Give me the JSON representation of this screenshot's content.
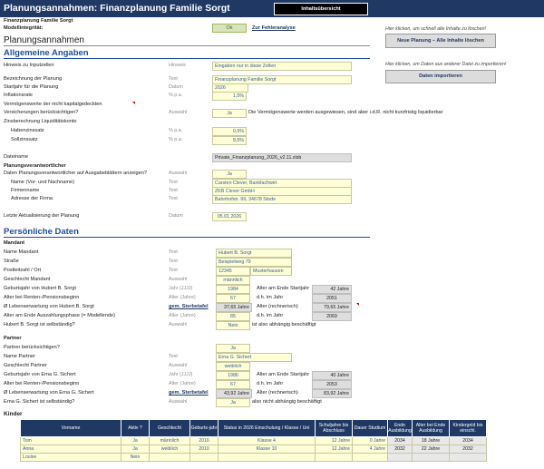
{
  "header": {
    "title": "Planungsannahmen: Finanzplanung Familie Sorgt",
    "overview_button": "Inhaltsübersicht"
  },
  "top": {
    "plan_title": "Finanzplanung Familie Sorgt",
    "integrity_label": "Modellintegrität:",
    "integrity_value": "Ok",
    "error_link": "Zur Fehleranalyse",
    "section_title": "Planungsannahmen",
    "hint_delete": "Hier klicken, um schnell alle Inhalte zu löschen!",
    "new_plan_button": "Neue Planung – Alle Inhalte löschen",
    "hint_import": "Hier klicken, um Daten aus anderer Datei zu importieren!",
    "import_button": "Daten importieren"
  },
  "general": {
    "heading": "Allgemeine Angaben",
    "hint_label": "Hinweis zu Inputzellen",
    "hint_unit": "Hinweis",
    "hint_value": "Eingaben nur in diese Zellen",
    "name_label": "Bezeichnung der Planung",
    "name_unit": "Text",
    "name_value": "Finanzplanung Familie Sorgt",
    "startyear_label": "Startjahr für die Planung",
    "startyear_unit": "Datum",
    "startyear_value": "2026",
    "inflation_label": "Inflationsrate",
    "inflation_unit": "% p.a.",
    "inflation_value": "1,5%",
    "assets_label": "Vermögenswerte der nicht kapitalgedeckten",
    "insurance_label": "Versicherungen berücksichtigen?",
    "insurance_unit": "Auswahl",
    "insurance_value": "Ja",
    "insurance_note": "Die Vermögenswerte werden ausgewiesen, sind aber i.d.R. nicht kurzfristig liquidierbar",
    "interest_label": "Zinsberechnung Liquiditätskonto",
    "credit_label": "Habenzinssatz",
    "credit_unit": "% p.a.",
    "credit_value": "0,5%",
    "debit_label": "Sollzinssatz",
    "debit_unit": "% p.a.",
    "debit_value": "9,5%",
    "filename_label": "Dateiname",
    "filename_value": "Private_Finanzplanung_2026_v2.11.xlsb",
    "resp_heading": "Planungsverantwortlicher",
    "resp_show_label": "Daten Planungsverantwortlicher auf Ausgabeblättern anzeigen?",
    "resp_show_unit": "Auswahl",
    "resp_show_value": "Ja",
    "resp_name_label": "Name (Vor- und Nachname)",
    "resp_name_unit": "Text",
    "resp_name_value": "Carsten Clever, Bankfachwirt",
    "resp_company_label": "Firmenname",
    "resp_company_unit": "Text",
    "resp_company_value": "ZKB Clever GmbH",
    "resp_address_label": "Adresse der Firma",
    "resp_address_unit": "Text",
    "resp_address_value": "Bahnhofstr. 99, 34678 Stode",
    "update_label": "Letzte Aktualisierung der Planung",
    "update_unit": "Datum",
    "update_value": "05.01.2026"
  },
  "personal": {
    "heading": "Persönliche Daten",
    "mandant_heading": "Mandant",
    "name_label": "Name Mandant",
    "name_unit": "Text",
    "name_value": "Hubert B. Sorgt",
    "street_label": "Straße",
    "street_unit": "Text",
    "street_value": "Beispielweg 79",
    "zip_label": "Postleitzahl / Ort",
    "zip_unit": "Text",
    "zip_value": "12345",
    "city_value": "Musterhausen",
    "gender_label": "Geschlecht Mandant",
    "gender_unit": "Auswahl",
    "gender_value": "männlich",
    "birth_label": "Geburtsjahr von Hubert B. Sorgt",
    "birth_unit": "Jahr (JJJJ)",
    "birth_value": "1984",
    "age_start_label": "Alter am Ende Startjahr",
    "age_start_value": "42 Jahre",
    "retire_label": "Alter bei Renten-/Pensionsbeginn",
    "retire_unit": "Alter (Jahre)",
    "retire_value": "67",
    "retire_year_label": "d.h. im Jahr",
    "retire_year_value": "2051",
    "life_label": "Ø Lebenserwartung von Hubert B. Sorgt",
    "life_link": "gem. Sterbetafel",
    "life_value": "37,65 Jahre",
    "life_calc_label": "Alter (rechnerisch)",
    "life_calc_value": "79,65 Jahre",
    "payout_label": "Alter am Ende Auszahlungsphase (= Modellende)",
    "payout_unit": "Alter (Jahre)",
    "payout_value": "85",
    "payout_year_label": "d.h. im Jahr",
    "payout_year_value": "2069",
    "self_label": "Hubert B. Sorgt ist selbständig?",
    "self_unit": "Auswahl",
    "self_value": "Nein",
    "self_note": "ist also abhängig beschäftigt"
  },
  "partner": {
    "heading": "Partner",
    "consider_label": "Partner berücksichtigen?",
    "consider_value": "Ja",
    "name_label": "Name Partner",
    "name_unit": "Text",
    "name_value": "Erna G. Sichert",
    "gender_label": "Geschlecht Partner",
    "gender_unit": "Auswahl",
    "gender_value": "weiblich",
    "birth_label": "Geburtsjahr von Erna G. Sichert",
    "birth_unit": "Jahr (JJJJ)",
    "birth_value": "1986",
    "age_start_label": "Alter am Ende Startjahr",
    "age_start_value": "40 Jahre",
    "retire_label": "Alter bei Renten-/Pensionsbeginn",
    "retire_unit": "Alter (Jahre)",
    "retire_value": "67",
    "retire_year_label": "d.h. im Jahr",
    "retire_year_value": "2053",
    "life_label": "Ø Lebenserwartung von Erna G. Sichert",
    "life_link": "gem. Sterbetafel",
    "life_value": "43,92 Jahre",
    "life_calc_label": "Alter (rechnerisch)",
    "life_calc_value": "83,92 Jahre",
    "self_label": "Erna G. Sichert ist selbständig?",
    "self_unit": "Auswahl",
    "self_value": "Ja",
    "self_note": "also nicht abhängig beschäftigt"
  },
  "kids": {
    "heading": "Kinder",
    "columns": [
      "Vorname",
      "Aktiv ?",
      "Geschlecht",
      "Geburts-jahr",
      "Status in 2026 Einschulung / Klasse / Uni",
      "Schuljahre bis Abschluss",
      "Dauer Studium",
      "Ende Ausbildung",
      "Alter bei Ende Ausbildung",
      "Kindergeld bis einschl."
    ],
    "rows": [
      [
        "Tom",
        "Ja",
        "männlich",
        "2016",
        "Klasse 4",
        "12 Jahre",
        "0 Jahre",
        "2034",
        "18 Jahre",
        "2034"
      ],
      [
        "Anna",
        "Ja",
        "weiblich",
        "2010",
        "Klasse 10",
        "12 Jahre",
        "4 Jahre",
        "2032",
        "22 Jahre",
        "2032"
      ],
      [
        "Louise",
        "Nein",
        "",
        "",
        "",
        "",
        "",
        "",
        "",
        ""
      ]
    ]
  }
}
